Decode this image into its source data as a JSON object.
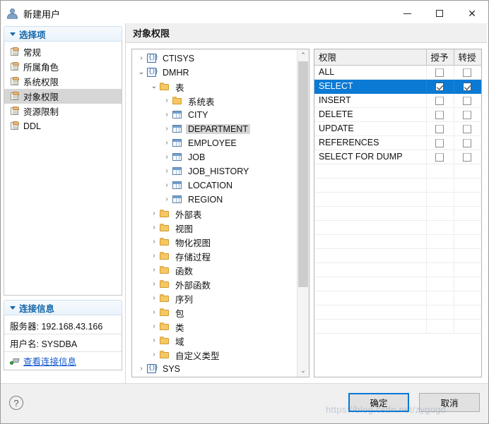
{
  "window": {
    "title": "新建用户",
    "icon": "user-icon",
    "minimize_label": "最小化",
    "maximize_label": "最大化",
    "close_label": "关闭"
  },
  "sidebar": {
    "group_title": "选择项",
    "items": [
      {
        "label": "常规",
        "icon": "page-icon",
        "active": false
      },
      {
        "label": "所属角色",
        "icon": "page-icon",
        "active": false
      },
      {
        "label": "系统权限",
        "icon": "page-icon",
        "active": false
      },
      {
        "label": "对象权限",
        "icon": "page-icon",
        "active": true
      },
      {
        "label": "资源限制",
        "icon": "page-icon",
        "active": false
      },
      {
        "label": "DDL",
        "icon": "page-icon",
        "active": false
      }
    ],
    "connection": {
      "group_title": "连接信息",
      "server_label": "服务器: 192.168.43.166",
      "user_label": "用户名: SYSDBA",
      "link_label": "查看连接信息",
      "link_icon": "plug-icon"
    }
  },
  "main": {
    "pane_title": "对象权限",
    "tree": [
      {
        "label": "CTISYS",
        "indent": 0,
        "expander": "collapsed",
        "icon": "schema-icon",
        "selected": false
      },
      {
        "label": "DMHR",
        "indent": 0,
        "expander": "expanded",
        "icon": "schema-icon",
        "selected": false
      },
      {
        "label": "表",
        "indent": 1,
        "expander": "expanded",
        "icon": "folder-icon",
        "selected": false
      },
      {
        "label": "系统表",
        "indent": 2,
        "expander": "collapsed",
        "icon": "folder-icon",
        "selected": false
      },
      {
        "label": "CITY",
        "indent": 2,
        "expander": "collapsed",
        "icon": "table-icon",
        "selected": false
      },
      {
        "label": "DEPARTMENT",
        "indent": 2,
        "expander": "collapsed",
        "icon": "table-icon",
        "selected": true
      },
      {
        "label": "EMPLOYEE",
        "indent": 2,
        "expander": "collapsed",
        "icon": "table-icon",
        "selected": false
      },
      {
        "label": "JOB",
        "indent": 2,
        "expander": "collapsed",
        "icon": "table-icon",
        "selected": false
      },
      {
        "label": "JOB_HISTORY",
        "indent": 2,
        "expander": "collapsed",
        "icon": "table-icon",
        "selected": false
      },
      {
        "label": "LOCATION",
        "indent": 2,
        "expander": "collapsed",
        "icon": "table-icon",
        "selected": false
      },
      {
        "label": "REGION",
        "indent": 2,
        "expander": "collapsed",
        "icon": "table-icon",
        "selected": false
      },
      {
        "label": "外部表",
        "indent": 1,
        "expander": "collapsed",
        "icon": "folder-icon",
        "selected": false
      },
      {
        "label": "视图",
        "indent": 1,
        "expander": "collapsed",
        "icon": "folder-icon",
        "selected": false
      },
      {
        "label": "物化视图",
        "indent": 1,
        "expander": "collapsed",
        "icon": "folder-icon",
        "selected": false
      },
      {
        "label": "存储过程",
        "indent": 1,
        "expander": "collapsed",
        "icon": "folder-icon",
        "selected": false
      },
      {
        "label": "函数",
        "indent": 1,
        "expander": "collapsed",
        "icon": "folder-icon",
        "selected": false
      },
      {
        "label": "外部函数",
        "indent": 1,
        "expander": "collapsed",
        "icon": "folder-icon",
        "selected": false
      },
      {
        "label": "序列",
        "indent": 1,
        "expander": "collapsed",
        "icon": "folder-icon",
        "selected": false
      },
      {
        "label": "包",
        "indent": 1,
        "expander": "collapsed",
        "icon": "folder-icon",
        "selected": false
      },
      {
        "label": "类",
        "indent": 1,
        "expander": "collapsed",
        "icon": "folder-icon",
        "selected": false
      },
      {
        "label": "域",
        "indent": 1,
        "expander": "collapsed",
        "icon": "folder-icon",
        "selected": false
      },
      {
        "label": "自定义类型",
        "indent": 1,
        "expander": "collapsed",
        "icon": "folder-icon",
        "selected": false
      },
      {
        "label": "SYS",
        "indent": 0,
        "expander": "collapsed",
        "icon": "schema-icon",
        "selected": false
      }
    ],
    "permissions": {
      "columns": [
        "权限",
        "授予",
        "转授"
      ],
      "rows": [
        {
          "name": "ALL",
          "grant": false,
          "grantable": false,
          "selected": false
        },
        {
          "name": "SELECT",
          "grant": true,
          "grantable": true,
          "selected": true
        },
        {
          "name": "INSERT",
          "grant": false,
          "grantable": false,
          "selected": false
        },
        {
          "name": "DELETE",
          "grant": false,
          "grantable": false,
          "selected": false
        },
        {
          "name": "UPDATE",
          "grant": false,
          "grantable": false,
          "selected": false
        },
        {
          "name": "REFERENCES",
          "grant": false,
          "grantable": false,
          "selected": false
        },
        {
          "name": "SELECT FOR DUMP",
          "grant": false,
          "grantable": false,
          "selected": false
        }
      ],
      "empty_rows": 12
    }
  },
  "footer": {
    "help_label": "?",
    "ok_label": "确定",
    "cancel_label": "取消"
  },
  "watermark": "https://blog.csdn.net/zygogo",
  "colors": {
    "selection_blue": "#0b7ad4",
    "link_blue": "#1155cc",
    "group_header_blue": "#1565a8",
    "focus_border": "#0078d7"
  }
}
